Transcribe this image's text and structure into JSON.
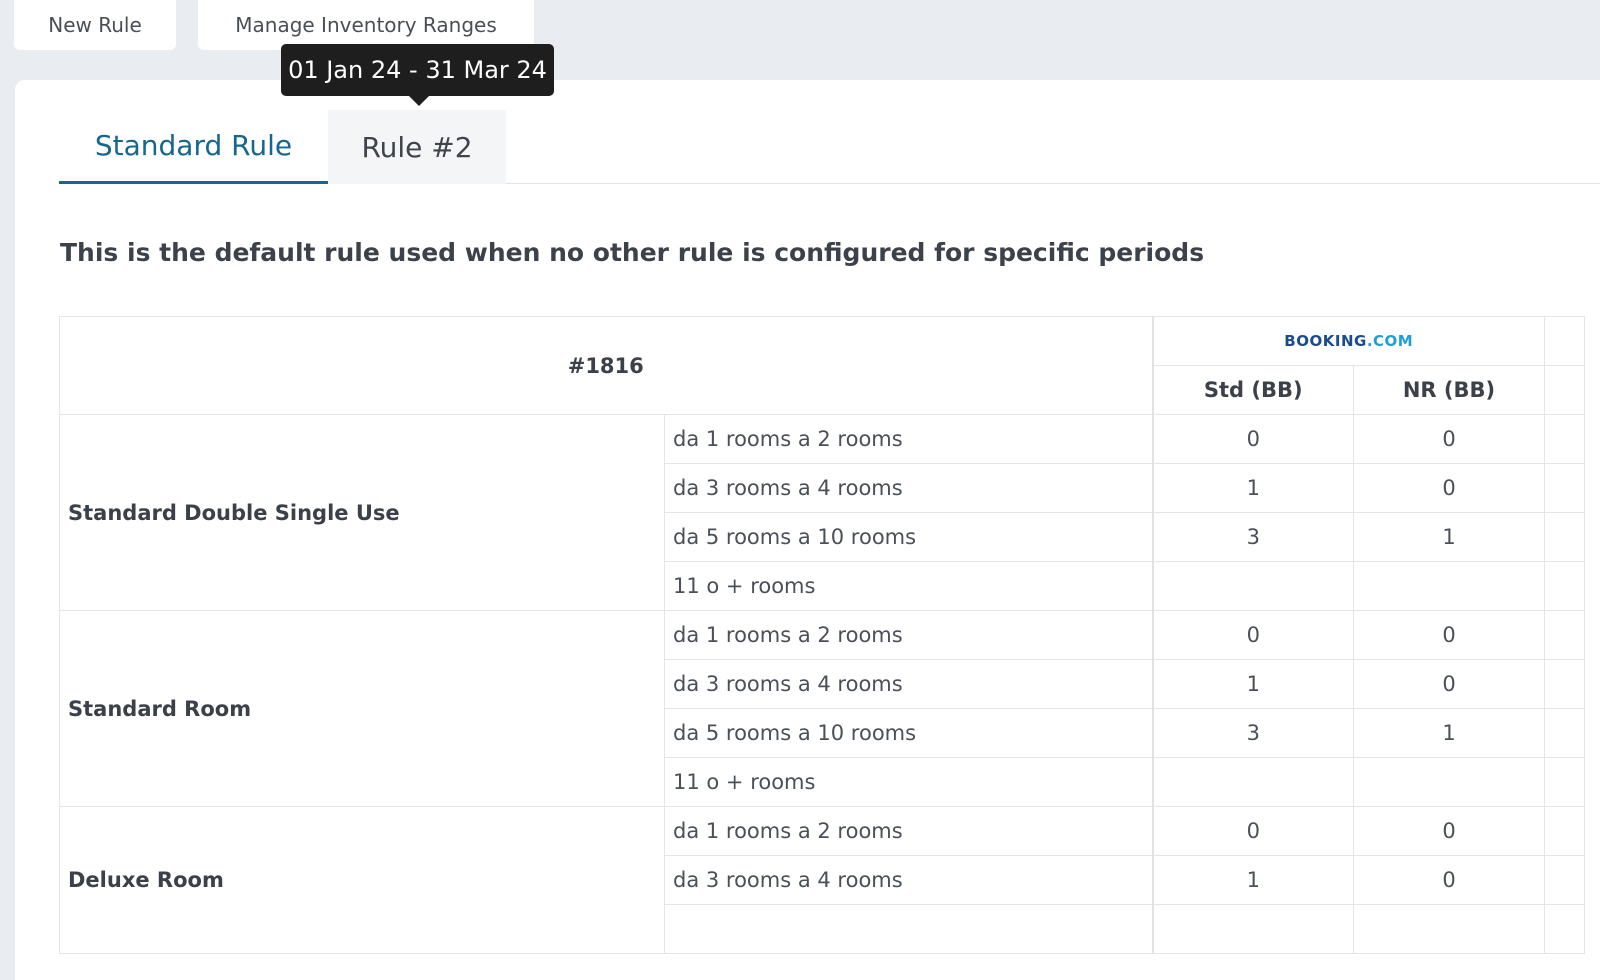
{
  "top_buttons": {
    "new_rule": "New Rule",
    "manage_ranges": "Manage Inventory Ranges"
  },
  "tooltip": "01 Jan 24 - 31 Mar 24",
  "tabs": [
    {
      "label": "Standard Rule",
      "active": true
    },
    {
      "label": "Rule #2",
      "active": false
    }
  ],
  "description": "This is the default rule used when no other rule is configured for specific periods",
  "table": {
    "id_header": "#1816",
    "channel": {
      "name": "BOOKING",
      "suffix": ".COM"
    },
    "columns": [
      "Std (BB)",
      "NR (BB)"
    ],
    "rooms": [
      {
        "name": "Standard Double Single Use",
        "rows": [
          {
            "range": "da 1 rooms a 2 rooms",
            "std": "0",
            "nr": "0"
          },
          {
            "range": "da 3 rooms a 4 rooms",
            "std": "1",
            "nr": "0"
          },
          {
            "range": "da 5 rooms a 10 rooms",
            "std": "3",
            "nr": "1"
          },
          {
            "range": "11 o + rooms",
            "std": "",
            "nr": ""
          }
        ]
      },
      {
        "name": "Standard Room",
        "rows": [
          {
            "range": "da 1 rooms a 2 rooms",
            "std": "0",
            "nr": "0"
          },
          {
            "range": "da 3 rooms a 4 rooms",
            "std": "1",
            "nr": "0"
          },
          {
            "range": "da 5 rooms a 10 rooms",
            "std": "3",
            "nr": "1"
          },
          {
            "range": "11 o + rooms",
            "std": "",
            "nr": ""
          }
        ]
      },
      {
        "name": "Deluxe Room",
        "rows": [
          {
            "range": "da 1 rooms a 2 rooms",
            "std": "0",
            "nr": "0"
          },
          {
            "range": "da 3 rooms a 4 rooms",
            "std": "1",
            "nr": "0"
          },
          {
            "range": "",
            "std": "",
            "nr": ""
          }
        ]
      }
    ]
  }
}
